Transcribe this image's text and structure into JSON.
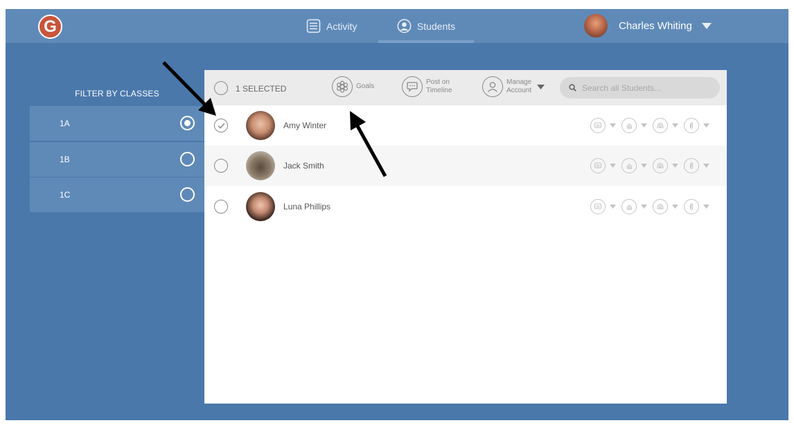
{
  "app": {
    "logo_letter": "G",
    "logo_color": "#c8553b"
  },
  "nav": {
    "activity_label": "Activity",
    "students_label": "Students",
    "user_name": "Charles Whiting"
  },
  "sidebar": {
    "title": "FILTER BY CLASSES",
    "classes": [
      {
        "label": "1A",
        "selected": true
      },
      {
        "label": "1B",
        "selected": false
      },
      {
        "label": "1C",
        "selected": false
      }
    ]
  },
  "toolbar": {
    "selected_count": "1 SELECTED",
    "goals_label": "Goals",
    "post_label_line1": "Post on",
    "post_label_line2": "Timeline",
    "manage_label_line1": "Manage",
    "manage_label_line2": "Account",
    "search_placeholder": "Search all Students..."
  },
  "students": [
    {
      "name": "Amy Winter",
      "checked": true
    },
    {
      "name": "Jack Smith",
      "checked": false
    },
    {
      "name": "Luna Phillips",
      "checked": false
    }
  ],
  "colors": {
    "background": "#4a78ab",
    "header": "#5f8ab8",
    "panel": "#ffffff",
    "toolbar": "#ebebeb"
  },
  "icons": {
    "activity": "list-icon",
    "students": "user-circle-icon",
    "goals": "flower-icon",
    "post": "chat-bubble-icon",
    "manage": "user-outline-icon",
    "search": "search-icon",
    "row_actions": [
      "message-icon",
      "hand-icon",
      "badge-icon",
      "paperclip-icon"
    ]
  }
}
